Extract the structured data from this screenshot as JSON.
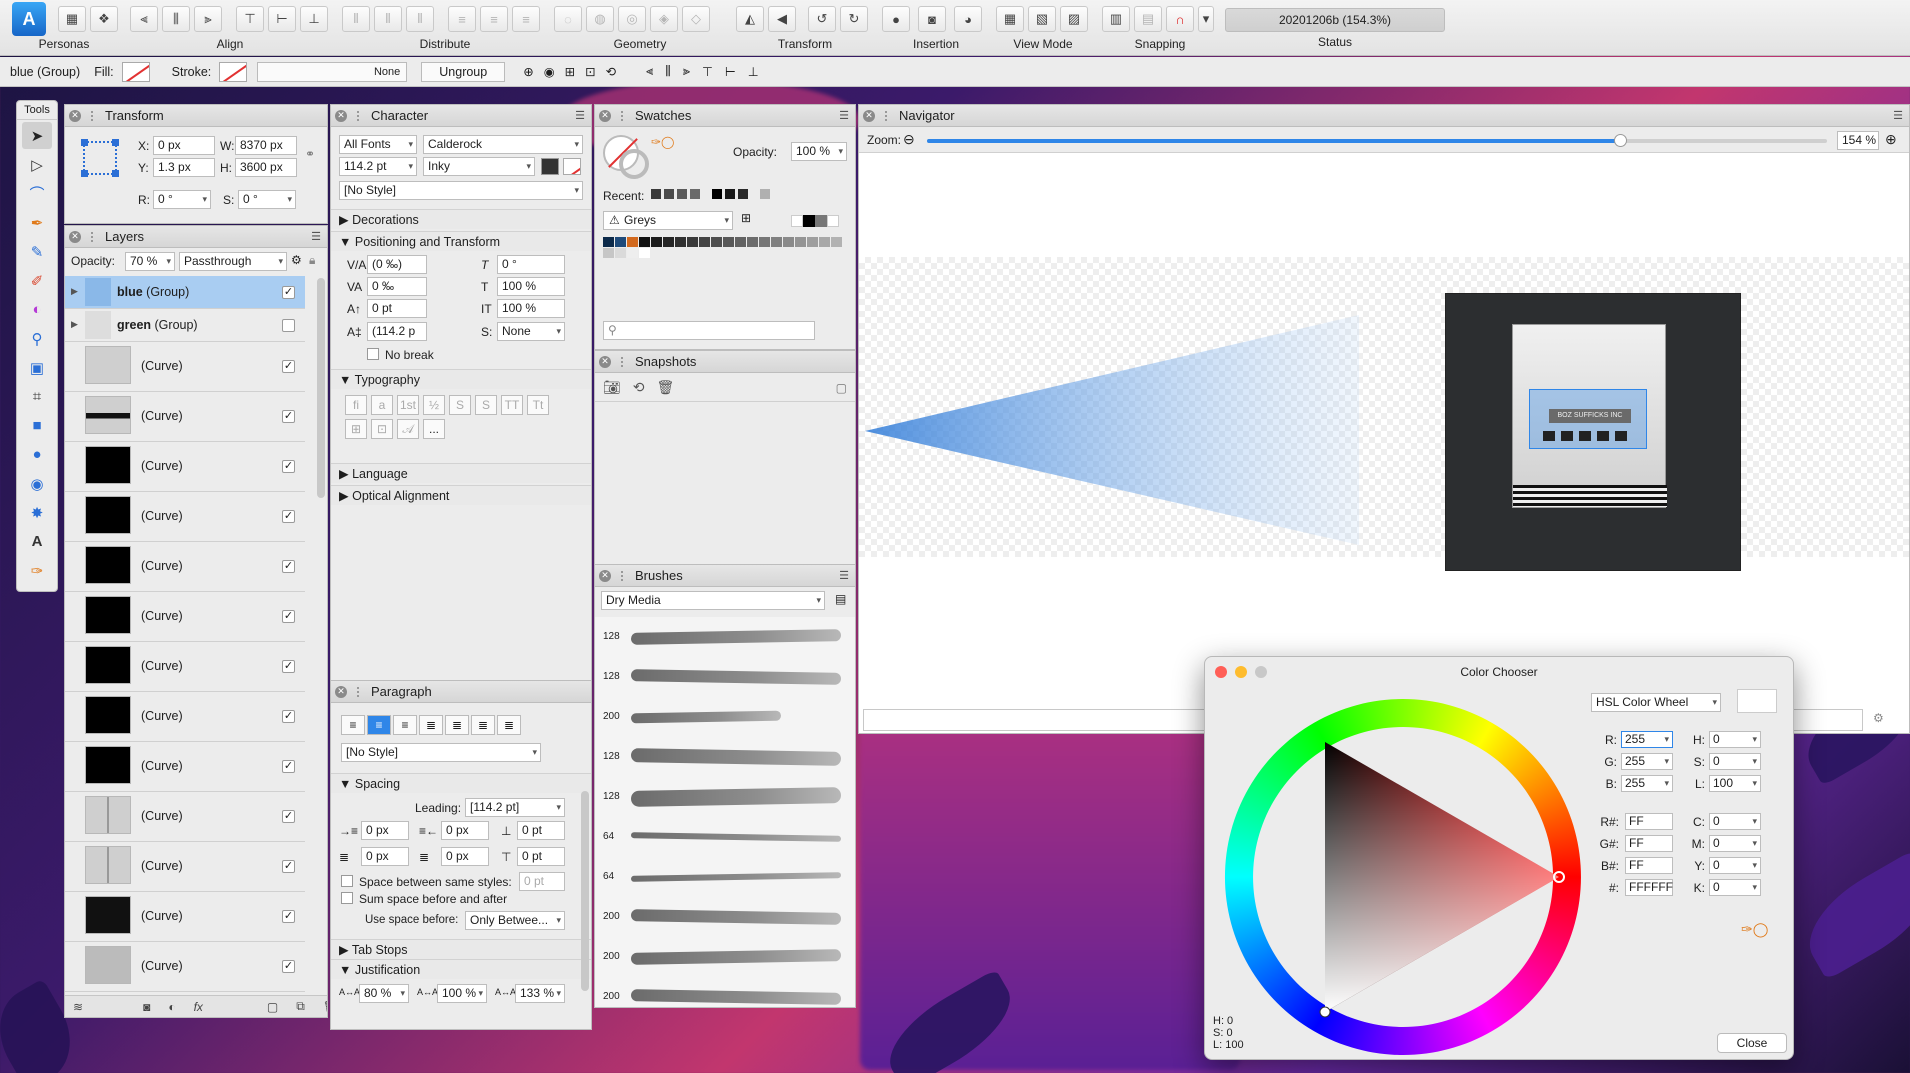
{
  "toolbar": {
    "personas_label": "Personas",
    "groups": [
      {
        "label": "Align"
      },
      {
        "label": "Distribute"
      },
      {
        "label": "Geometry"
      },
      {
        "label": "Transform"
      },
      {
        "label": "Insertion"
      },
      {
        "label": "View Mode"
      },
      {
        "label": "Snapping"
      },
      {
        "label": "Status"
      }
    ],
    "status_text": "20201206b (154.3%)"
  },
  "context_bar": {
    "selection": "blue (Group)",
    "fill_label": "Fill:",
    "stroke_label": "Stroke:",
    "stroke_value": "None",
    "ungroup_label": "Ungroup"
  },
  "tools_panel": {
    "title": "Tools"
  },
  "transform": {
    "title": "Transform",
    "x_label": "X:",
    "x_value": "0 px",
    "y_label": "Y:",
    "y_value": "1.3 px",
    "w_label": "W:",
    "w_value": "8370 px",
    "h_label": "H:",
    "h_value": "3600 px",
    "r_label": "R:",
    "r_value": "0 °",
    "s_label": "S:",
    "s_value": "0 °"
  },
  "layers": {
    "title": "Layers",
    "opacity_label": "Opacity:",
    "opacity_value": "70 %",
    "blend_mode": "Passthrough",
    "rows": [
      {
        "name": "blue",
        "suffix": " (Group)",
        "checked": true
      },
      {
        "name": "green",
        "suffix": " (Group)",
        "checked": false
      },
      {
        "name": "(Curve)",
        "checked": true
      },
      {
        "name": "(Curve)",
        "checked": true
      },
      {
        "name": "(Curve)",
        "checked": true
      },
      {
        "name": "(Curve)",
        "checked": true
      },
      {
        "name": "(Curve)",
        "checked": true
      },
      {
        "name": "(Curve)",
        "checked": true
      },
      {
        "name": "(Curve)",
        "checked": true
      },
      {
        "name": "(Curve)",
        "checked": true
      },
      {
        "name": "(Curve)",
        "checked": true
      },
      {
        "name": "(Curve)",
        "checked": true
      },
      {
        "name": "(Curve)",
        "checked": true
      },
      {
        "name": "(Curve)",
        "checked": true
      },
      {
        "name": "(Curve)",
        "checked": true
      }
    ]
  },
  "character": {
    "title": "Character",
    "font_collection": "All Fonts",
    "font_family": "Calderock",
    "font_size": "114.2 pt",
    "font_style": "Inky",
    "text_style": "[No Style]",
    "sections": {
      "decorations": "Decorations",
      "positioning": "Positioning and Transform",
      "typography": "Typography",
      "language": "Language",
      "optical": "Optical Alignment"
    },
    "kerning": "(0 ‰)",
    "tracking": "0 ‰",
    "baseline": "0 pt",
    "leading_small": "(114.2 p",
    "skew": "0 °",
    "scale_x": "100 %",
    "scale_y": "100 %",
    "superscript_label": "S:",
    "superscript": "None",
    "no_break": "No break",
    "more_label": "..."
  },
  "paragraph": {
    "title": "Paragraph",
    "style": "[No Style]",
    "spacing_label": "Spacing",
    "leading_label": "Leading:",
    "leading_value": "[114.2 pt]",
    "left_indent": "0 px",
    "right_indent": "0 px",
    "space_before": "0 pt",
    "first_indent": "0 px",
    "space_after_indent": "0 px",
    "space_after": "0 pt",
    "same_styles_label": "Space between same styles:",
    "same_styles_value": "0 pt",
    "sum_space_label": "Sum space before and after",
    "use_space_label": "Use space before:",
    "use_space_value": "Only Betwee...",
    "tab_stops": "Tab Stops",
    "justification": "Justification",
    "just_1": "80 %",
    "just_2": "100 %",
    "just_3": "133 %"
  },
  "swatches": {
    "title": "Swatches",
    "opacity_label": "Opacity:",
    "opacity_value": "100 %",
    "recent_label": "Recent:",
    "palette": "Greys",
    "recent_colors": [
      "#3a3a3a",
      "#4a4a4a",
      "#5a5a5a",
      "#6a6a6a",
      "#000000",
      "#1a1a1a",
      "#2a2a2a",
      "#b0b0b0"
    ],
    "palette_colors": [
      "#0c2a4a",
      "#1e4a7a",
      "#d2691e",
      "#111111",
      "#1c1c1c",
      "#262626",
      "#303030",
      "#3a3a3a",
      "#444444",
      "#4e4e4e",
      "#585858",
      "#626262",
      "#6c6c6c",
      "#767676",
      "#808080",
      "#8a8a8a",
      "#949494",
      "#9e9e9e",
      "#a8a8a8",
      "#b2b2b2",
      "#c6c6c6",
      "#dadada",
      "#eeeeee",
      "#ffffff"
    ]
  },
  "snapshots": {
    "title": "Snapshots"
  },
  "brushes": {
    "title": "Brushes",
    "category": "Dry Media",
    "sizes": [
      "128",
      "128",
      "200",
      "128",
      "128",
      "64",
      "64",
      "200",
      "200",
      "200"
    ]
  },
  "navigator": {
    "title": "Navigator",
    "zoom_label": "Zoom:",
    "zoom_value": "154 %",
    "zoom_fraction": 0.77,
    "preview_sign": "BOZ SUFFICKS INC"
  },
  "color_chooser": {
    "title": "Color Chooser",
    "mode": "HSL Color Wheel",
    "r_label": "R:",
    "r": "255",
    "g_label": "G:",
    "g": "255",
    "b_label": "B:",
    "b": "255",
    "h_label": "H:",
    "h": "0",
    "s_label": "S:",
    "s": "0",
    "l_label": "L:",
    "l": "100",
    "rh_label": "R#:",
    "rh": "FF",
    "gh_label": "G#:",
    "gh": "FF",
    "bh_label": "B#:",
    "bh": "FF",
    "hex_label": "#:",
    "hex": "FFFFFF",
    "c_label": "C:",
    "c": "0",
    "m_label": "M:",
    "m": "0",
    "y_label": "Y:",
    "y": "0",
    "k_label": "K:",
    "k": "0",
    "readout_h": "H: 0",
    "readout_s": "S: 0",
    "readout_l": "L: 100",
    "close_label": "Close"
  }
}
